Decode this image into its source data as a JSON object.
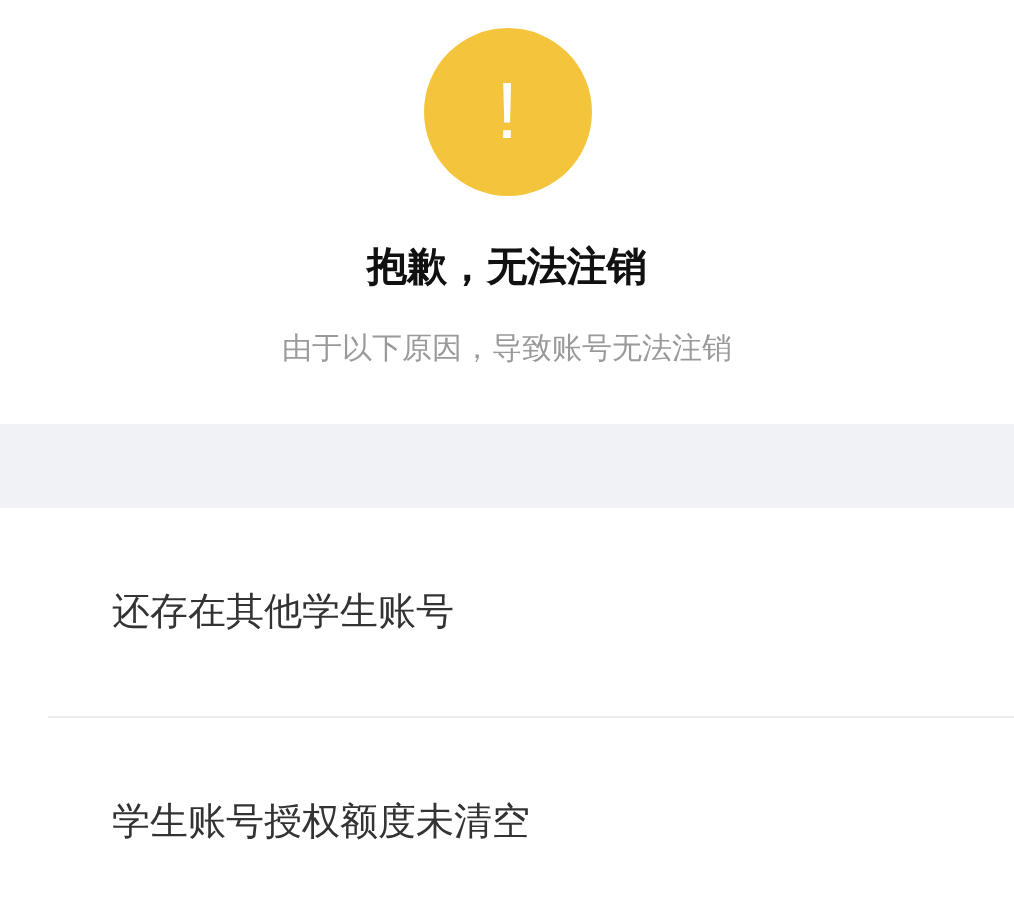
{
  "alert": {
    "icon": "!",
    "title": "抱歉，无法注销",
    "subtitle": "由于以下原因，导致账号无法注销"
  },
  "reasons": [
    "还存在其他学生账号",
    "学生账号授权额度未清空"
  ]
}
